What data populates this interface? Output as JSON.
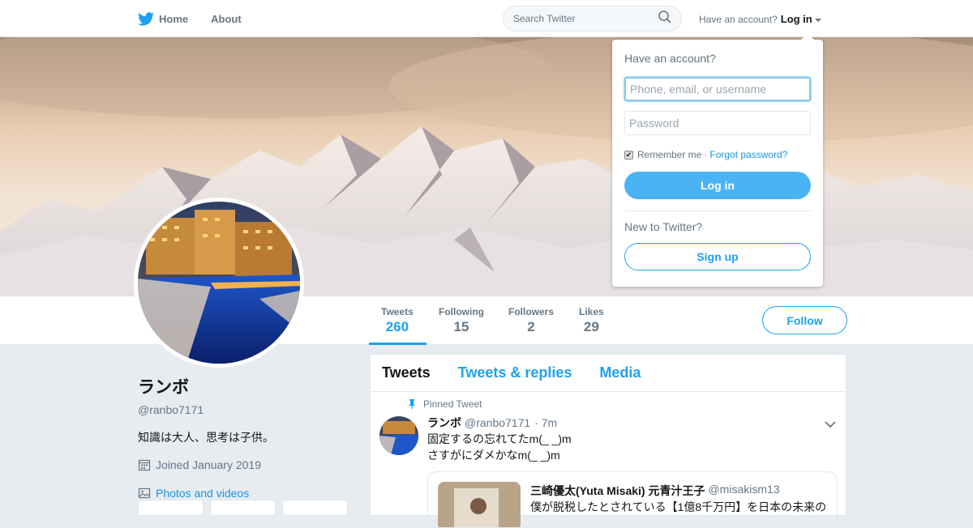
{
  "topbar": {
    "nav": [
      {
        "label": "Home",
        "icon": "twitter-bird-icon"
      },
      {
        "label": "About"
      }
    ],
    "search": {
      "placeholder": "Search Twitter",
      "icon": "search-icon"
    },
    "account_prompt": "Have an account?",
    "login_label": "Log in",
    "brand_color": "#1da1f2"
  },
  "login_dropdown": {
    "title": "Have an account?",
    "username_placeholder": "Phone, email, or username",
    "password_placeholder": "Password",
    "remember_label": "Remember me",
    "separator": "·",
    "forgot_label": "Forgot password?",
    "login_button": "Log in",
    "new_prompt": "New to Twitter?",
    "signup_button": "Sign up",
    "remember_checked": true
  },
  "profile_nav": {
    "stats": [
      {
        "label": "Tweets",
        "value": "260",
        "active": true
      },
      {
        "label": "Following",
        "value": "15"
      },
      {
        "label": "Followers",
        "value": "2"
      },
      {
        "label": "Likes",
        "value": "29"
      }
    ],
    "follow_button": "Follow"
  },
  "profile": {
    "name": "ランボ",
    "handle": "@ranbo7171",
    "bio": "知識は大人、思考は子供。",
    "joined": "Joined January 2019",
    "photos_link": "Photos and videos"
  },
  "timeline": {
    "tabs": [
      "Tweets",
      "Tweets & replies",
      "Media"
    ],
    "pinned_tweet": {
      "pinned_label": "Pinned Tweet",
      "name": "ランボ",
      "handle": "@ranbo7171",
      "time": "· 7m",
      "lines": [
        "固定するの忘れてたm(_ _)m",
        "さすがにダメかなm(_ _)m"
      ],
      "quote": {
        "name": "三崎優太(Yuta Misaki) 元青汁王子",
        "handle": "@misakism13",
        "text": "僕が脱税したとされている【1億8千万円】を日本の未来の"
      }
    }
  }
}
